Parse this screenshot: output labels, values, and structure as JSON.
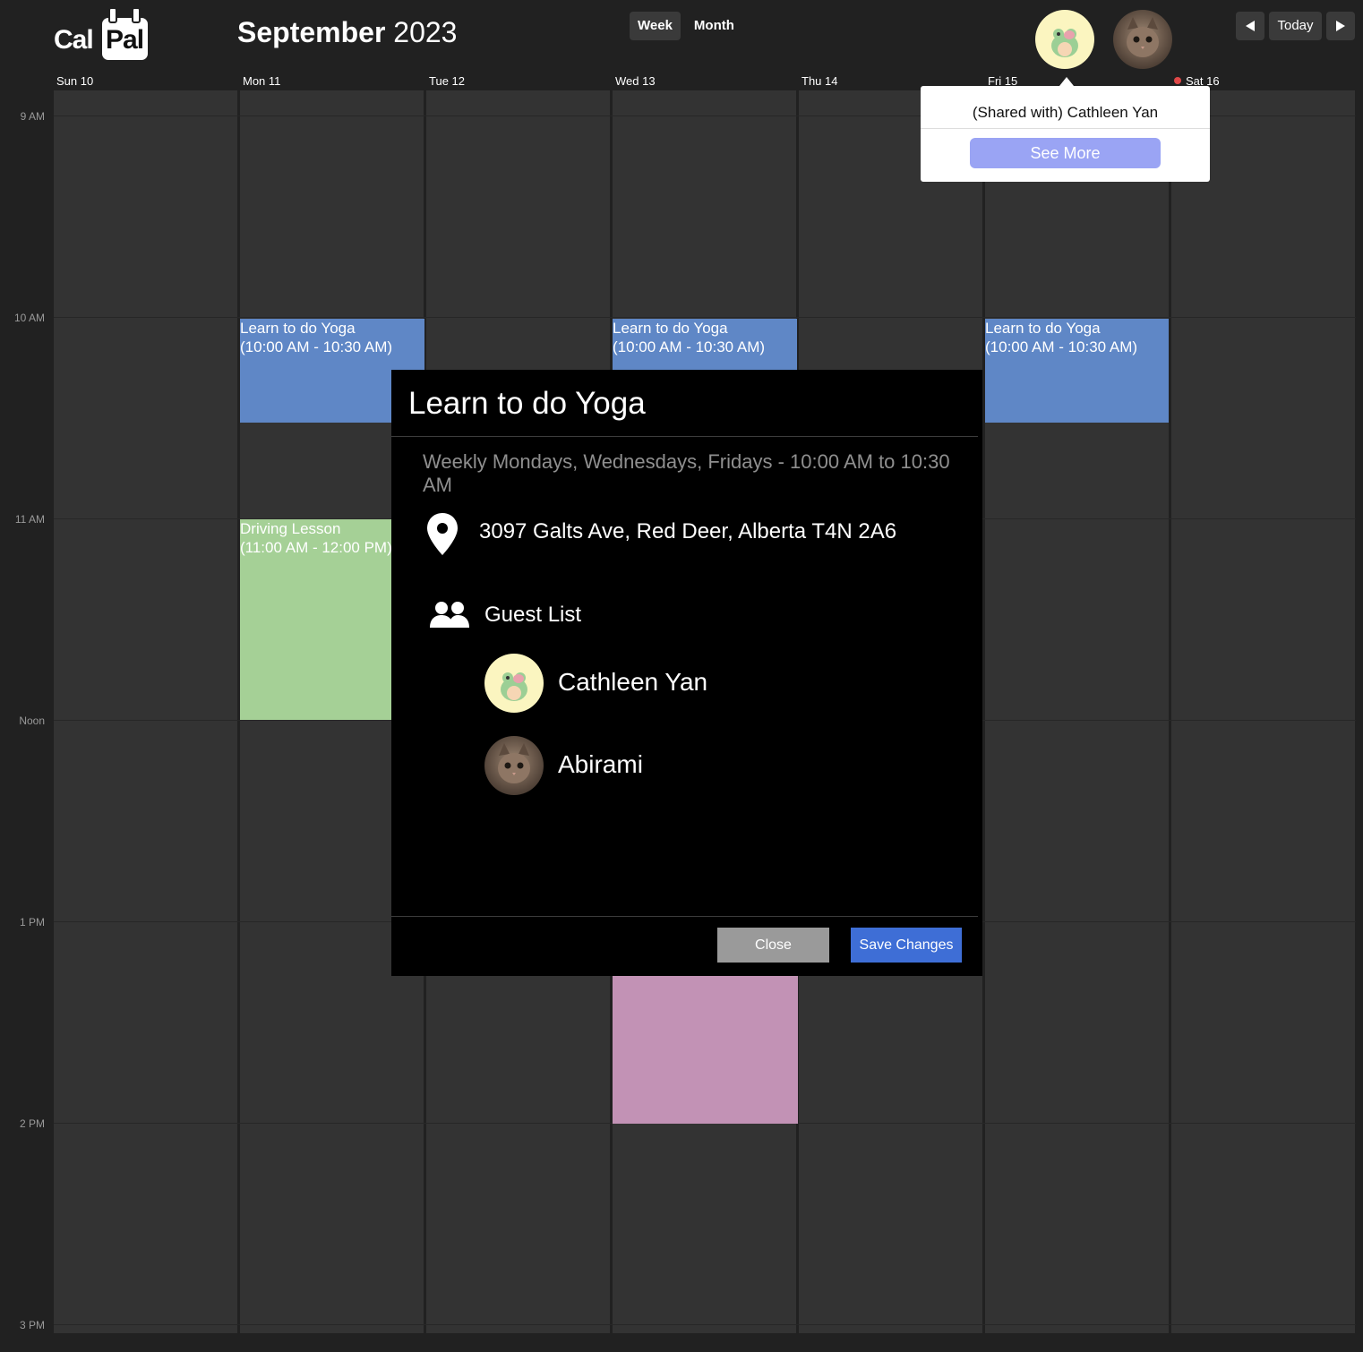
{
  "app": {
    "logo_part1": "Cal",
    "logo_part2": "Pal"
  },
  "header": {
    "month": "September",
    "year": "2023",
    "views": [
      "Week",
      "Month"
    ],
    "active_view": "Week",
    "today_label": "Today"
  },
  "days": [
    "Sun 10",
    "Mon 11",
    "Tue 12",
    "Wed 13",
    "Thu 14",
    "Fri 15",
    "Sat 16"
  ],
  "times": [
    "9 AM",
    "10 AM",
    "11 AM",
    "Noon",
    "1 PM",
    "2 PM",
    "3 PM"
  ],
  "events": [
    {
      "day": "Mon 11",
      "title": "Learn to do Yoga",
      "time": "(10:00 AM - 10:30 AM)",
      "color": "#5f87c6"
    },
    {
      "day": "Wed 13",
      "title": "Learn to do Yoga",
      "time": "(10:00 AM - 10:30 AM)",
      "color": "#5f87c6"
    },
    {
      "day": "Fri 15",
      "title": "Learn to do Yoga",
      "time": "(10:00 AM - 10:30 AM)",
      "color": "#5f87c6"
    },
    {
      "day": "Mon 11",
      "title": "Driving Lesson",
      "time": "(11:00 AM - 12:00 PM)",
      "color": "#a5d096"
    },
    {
      "day": "Wed 13",
      "title": "",
      "time": "",
      "color": "#c292b5"
    }
  ],
  "popover": {
    "shared_text": "(Shared with) Cathleen Yan",
    "see_more": "See More"
  },
  "modal": {
    "title": "Learn to do Yoga",
    "recurrence": "Weekly Mondays, Wednesdays, Fridays  -  10:00 AM to 10:30 AM",
    "address": "3097 Galts Ave, Red Deer, Alberta T4N 2A6",
    "guest_list_label": "Guest List",
    "guests": [
      {
        "name": "Cathleen Yan",
        "avatar": "frog-avatar"
      },
      {
        "name": "Abirami",
        "avatar": "kitten-avatar"
      }
    ],
    "close_label": "Close",
    "save_label": "Save Changes"
  },
  "colors": {
    "background": "#212121",
    "column": "#333333",
    "accent_blue": "#3e6ed6",
    "see_more": "#9aa4f4"
  }
}
